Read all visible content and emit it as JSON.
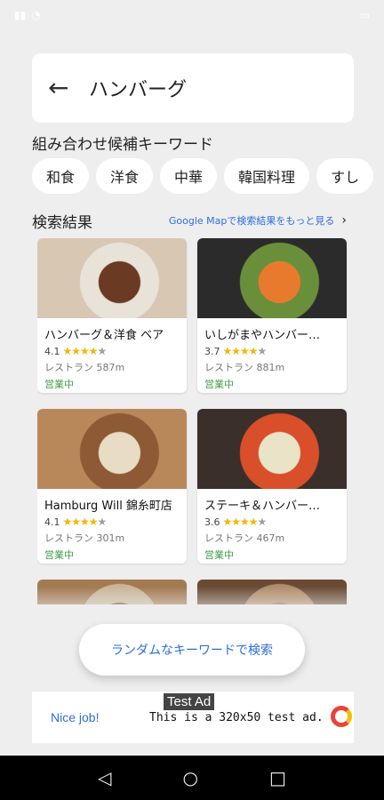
{
  "search": {
    "query": "ハンバーグ"
  },
  "keywords": {
    "title": "組み合わせ候補キーワード",
    "chips": [
      "和食",
      "洋食",
      "中華",
      "韓国料理",
      "すし"
    ]
  },
  "results": {
    "title": "検索結果",
    "more_link": "Google Mapで検索結果をもっと見る",
    "items": [
      {
        "name": "ハンバーグ＆洋食 ベア",
        "rating": "4.1",
        "stars": 4,
        "category": "レストラン 587m",
        "status": "営業中",
        "colors": [
          "#d7c7b3",
          "#6b3a22",
          "#e9e2d9"
        ]
      },
      {
        "name": "いしがまやハンバー…",
        "rating": "3.7",
        "stars": 4,
        "category": "レストラン 881m",
        "status": "営業中",
        "colors": [
          "#2b2b2b",
          "#e87a2e",
          "#6a8f3a"
        ]
      },
      {
        "name": "Hamburg Will 錦糸町店",
        "rating": "4.1",
        "stars": 4,
        "category": "レストラン 301m",
        "status": "営業中",
        "colors": [
          "#b9885a",
          "#e8dcc4",
          "#8e5a35"
        ]
      },
      {
        "name": "ステーキ＆ハンバー…",
        "rating": "3.6",
        "stars": 4,
        "category": "レストラン 467m",
        "status": "営業中",
        "colors": [
          "#3a2f2a",
          "#e9e3c8",
          "#d94f2a"
        ]
      },
      {
        "name": "",
        "rating": "",
        "stars": 0,
        "category": "",
        "status": "",
        "colors": [
          "#a37a52",
          "#6a4a30",
          "#c9b59a"
        ]
      },
      {
        "name": "",
        "rating": "",
        "stars": 0,
        "category": "",
        "status": "",
        "colors": [
          "#6a4a33",
          "#8c6a4e",
          "#b08c6c"
        ]
      }
    ]
  },
  "random_button": "ランダムなキーワードで検索",
  "ad": {
    "badge": "Test Ad",
    "nice": "Nice job!",
    "text": "This is a 320x50 test ad."
  },
  "navbar": {
    "back": "◁",
    "home": "○",
    "recents": "□"
  }
}
